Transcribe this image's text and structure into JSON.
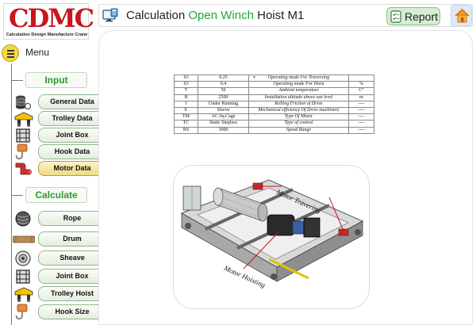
{
  "brand": {
    "letters": "CDMC",
    "subtitle": "Calculation Design Manufacture Crane",
    "red": "#c8161d"
  },
  "header": {
    "title_part1": "Calculation",
    "title_accent": "Open Winch",
    "title_part2": "Hoist M1",
    "accent_color": "#1fa63a",
    "report_label": "Report",
    "home_icon": "home-icon",
    "calc_icon": "calculator-monitor-icon"
  },
  "sidebar": {
    "menu_label": "Menu",
    "input_label": "Input",
    "calculate_label": "Calculate",
    "input_items": [
      {
        "label": "General Data",
        "icon": "database-icon"
      },
      {
        "label": "Trolley Data",
        "icon": "trolley-icon"
      },
      {
        "label": "Joint Box",
        "icon": "joint-box-icon"
      },
      {
        "label": "Hook Data",
        "icon": "hook-icon"
      },
      {
        "label": "Motor Data",
        "icon": "motor-icon",
        "active": true
      }
    ],
    "calculate_items": [
      {
        "label": "Rope",
        "icon": "rope-icon"
      },
      {
        "label": "Drum",
        "icon": "drum-icon"
      },
      {
        "label": "Sheave",
        "icon": "sheave-icon"
      },
      {
        "label": "Joint Box",
        "icon": "joint-box-icon"
      },
      {
        "label": "Trolley Hoist",
        "icon": "trolley-icon"
      },
      {
        "label": "Hook Size",
        "icon": "hook-icon"
      }
    ]
  },
  "motor_table": {
    "rows": [
      {
        "symbol": "S3",
        "value": "0.25",
        "dropdown": true,
        "description": "Operating mode For Traversing",
        "unit": ""
      },
      {
        "symbol": "S3",
        "value": "0.4",
        "dropdown": false,
        "description": "Operating mode For Hoist",
        "unit": "%"
      },
      {
        "symbol": "T",
        "value": "50",
        "dropdown": false,
        "description": "Ambient temperature",
        "unit": "C°"
      },
      {
        "symbol": "H",
        "value": "2500",
        "dropdown": false,
        "description": "Installation altitude above sea level",
        "unit": "m"
      },
      {
        "symbol": "f",
        "value": "Under Running",
        "dropdown": false,
        "description": "Rolling Friction of Drive",
        "unit": "----"
      },
      {
        "symbol": "E",
        "value": "Sleeve",
        "dropdown": false,
        "description": "Mechanical efficiency Of Drive machinery",
        "unit": "----"
      },
      {
        "symbol": "TM",
        "value": "AC.Sq.Cage",
        "dropdown": false,
        "description": "Type Of Motor",
        "unit": "----"
      },
      {
        "symbol": "TC",
        "value": "Static Stepless",
        "dropdown": false,
        "description": "Type of control",
        "unit": "----"
      },
      {
        "symbol": "RS",
        "value": "3000",
        "dropdown": false,
        "description": "Speed Range",
        "unit": "----"
      }
    ]
  },
  "illustration": {
    "label_traversing": "Motor Travering",
    "label_hoisting": "Motor Hoisting"
  }
}
